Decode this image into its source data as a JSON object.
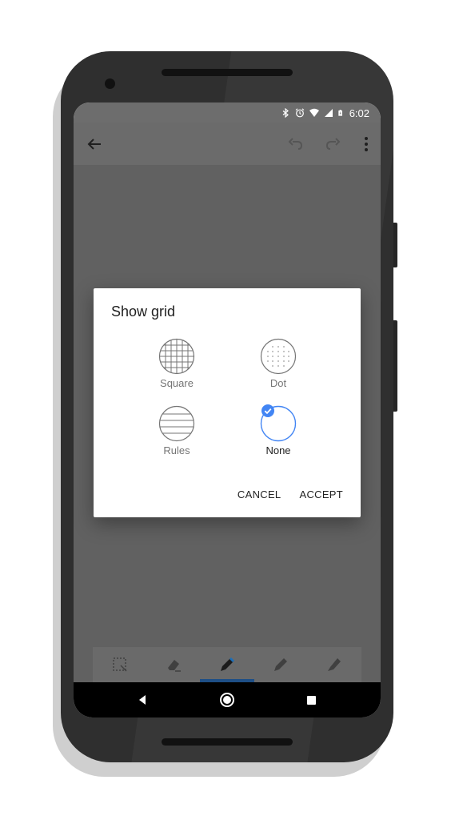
{
  "status": {
    "time": "6:02",
    "icons": [
      "bluetooth-icon",
      "alarm-icon",
      "wifi-icon",
      "signal-icon",
      "battery-charging-icon"
    ]
  },
  "appbar": {
    "icons": [
      "back-arrow-icon",
      "undo-icon",
      "redo-icon",
      "more-vert-icon"
    ]
  },
  "dialog": {
    "title": "Show grid",
    "options": [
      {
        "label": "Square",
        "icon": "square-grid-icon",
        "selected": false
      },
      {
        "label": "Dot",
        "icon": "dot-grid-icon",
        "selected": false
      },
      {
        "label": "Rules",
        "icon": "rules-grid-icon",
        "selected": false
      },
      {
        "label": "None",
        "icon": "no-grid-icon",
        "selected": true
      }
    ],
    "cancel_label": "CANCEL",
    "accept_label": "ACCEPT"
  },
  "toolbar": {
    "tools": [
      "selection-tool-icon",
      "eraser-icon",
      "pen-icon",
      "marker-icon",
      "highlighter-icon"
    ],
    "active_tool": "pen-icon"
  },
  "colors": {
    "accent": "#4285f4",
    "active_tool_underline": "#1e4f86",
    "scrim_canvas": "#616161"
  }
}
